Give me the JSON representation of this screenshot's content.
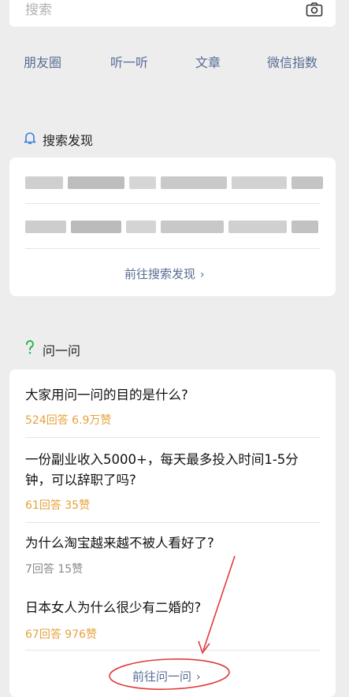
{
  "search": {
    "placeholder": "搜索"
  },
  "quicklinks": [
    "朋友圈",
    "听一听",
    "文章",
    "微信指数"
  ],
  "discover": {
    "title": "搜索发现",
    "link": "前往搜索发现"
  },
  "ask": {
    "title": "问一问",
    "questions": [
      {
        "title": "大家用问一问的目的是什么?",
        "stats": "524回答 6.9万赞"
      },
      {
        "title": "一份副业收入5000+，每天最多投入时间1-5分钟，可以辞职了吗?",
        "stats": "61回答 35赞"
      },
      {
        "title": "为什么淘宝越来越不被人看好了?",
        "stats": "7回答 15赞"
      },
      {
        "title": "日本女人为什么很少有二婚的?",
        "stats": "67回答 976赞"
      }
    ],
    "link": "前往问一问"
  },
  "colors": {
    "link": "#576b95",
    "highlight_stats": "#e6a23c",
    "annotation": "#e03a3a"
  }
}
